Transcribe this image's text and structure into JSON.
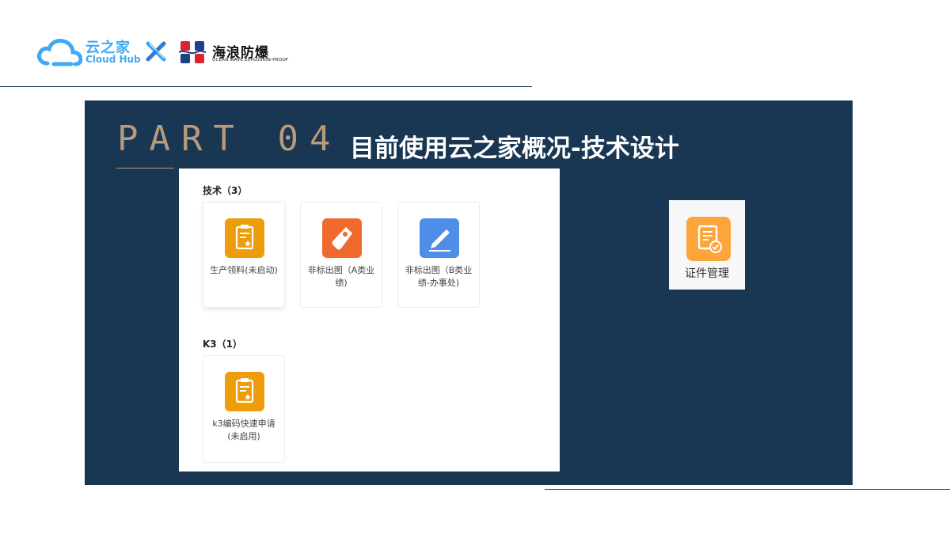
{
  "header": {
    "brand_cn": "云之家",
    "brand_en": "Cloud Hub",
    "partner_cn": "海浪防爆",
    "partner_en": "OCEAN WAVE EXPLOSION-PROOF"
  },
  "slide": {
    "part_label": "PART 04",
    "title": "目前使用云之家概况-技术设计"
  },
  "sections": [
    {
      "title": "技术（3）",
      "apps": [
        {
          "label": "生产领料(未启动)",
          "icon": "clipboard-star-icon",
          "color": "#ee9d0a"
        },
        {
          "label": "非标出图（A类业绩)",
          "icon": "price-tag-icon",
          "color": "#ef6a2c"
        },
        {
          "label": "非标出图（B类业绩-办事处)",
          "icon": "pencil-icon",
          "color": "#4f8ee8"
        }
      ]
    },
    {
      "title": "K3（1）",
      "apps": [
        {
          "label": "k3编码快速申请(未启用)",
          "icon": "clipboard-star-icon",
          "color": "#ee9d0a"
        }
      ]
    }
  ],
  "cert_app": {
    "label": "证件管理",
    "icon": "document-check-icon",
    "color": "#fba53a"
  },
  "colors": {
    "panel": "#193652",
    "accent_gold": "#b99a79",
    "cloud_blue": "#3fa9f5"
  }
}
